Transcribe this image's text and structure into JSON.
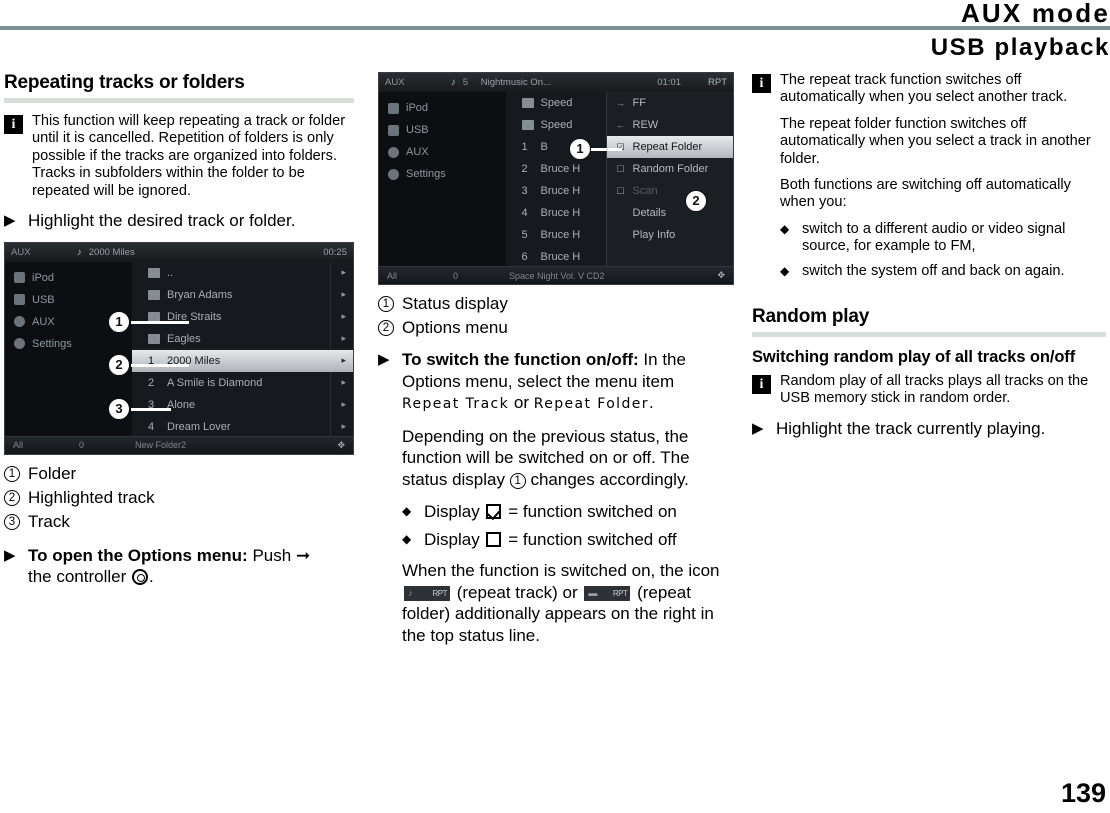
{
  "header": {
    "title": "AUX mode",
    "subtitle": "USB playback",
    "rule_color": "#7e9092"
  },
  "page_number": "139",
  "col1": {
    "section_title": "Repeating tracks or folders",
    "note": [
      "This function will keep repeating a track or folder until it is cancelled. Repetition of folders is only possible if the tracks are organized into folders. Tracks in subfolders within the folder to be repeated will be ignored."
    ],
    "action": "Highlight the desired track or folder.",
    "screenshot": {
      "top": {
        "source": "AUX",
        "icons": "♪",
        "title": "2000 Miles",
        "time": "00:25",
        "rpt": ""
      },
      "nav": [
        "iPod",
        "USB",
        "AUX",
        "Settings"
      ],
      "list": [
        {
          "kind": "folder",
          "label": "..",
          "selected": false
        },
        {
          "kind": "folder",
          "label": "Bryan Adams",
          "selected": false
        },
        {
          "kind": "folder",
          "label": "Dire Straits",
          "selected": false
        },
        {
          "kind": "folder",
          "label": "Eagles",
          "selected": false
        },
        {
          "kind": "track",
          "num": "1",
          "label": "2000 Miles",
          "selected": true
        },
        {
          "kind": "track",
          "num": "2",
          "label": "A Smile is Diamond",
          "selected": false
        },
        {
          "kind": "track",
          "num": "3",
          "label": "Alone",
          "selected": false
        },
        {
          "kind": "track",
          "num": "4",
          "label": "Dream Lover",
          "selected": false
        }
      ],
      "bottom": {
        "b1": "All",
        "b2": "0",
        "b3": "New Folder2",
        "b4": "✥"
      },
      "callouts": [
        "1",
        "2",
        "3"
      ]
    },
    "legend": [
      {
        "num": "1",
        "label": "Folder"
      },
      {
        "num": "2",
        "label": "Highlighted track"
      },
      {
        "num": "3",
        "label": "Track"
      }
    ],
    "action2_bold": "To open the Options menu:",
    "action2_rest": " Push",
    "action2_tail": "the controller"
  },
  "col2": {
    "screenshot": {
      "top": {
        "source": "AUX",
        "icons": "♪",
        "index": "5",
        "title": "Nightmusic On...",
        "time": "01:01",
        "rpt": "RPT"
      },
      "nav": [
        "iPod",
        "USB",
        "AUX",
        "Settings"
      ],
      "list": [
        {
          "kind": "folder",
          "label": "Speed",
          "selected": false
        },
        {
          "kind": "folder",
          "label": "Speed",
          "selected": false
        },
        {
          "kind": "track",
          "num": "1",
          "label": "B",
          "selected": false
        },
        {
          "kind": "track",
          "num": "2",
          "label": "Bruce H",
          "selected": false
        },
        {
          "kind": "track",
          "num": "3",
          "label": "Bruce H",
          "selected": false
        },
        {
          "kind": "track",
          "num": "4",
          "label": "Bruce H",
          "selected": false
        },
        {
          "kind": "track",
          "num": "5",
          "label": "Bruce H",
          "selected": false
        },
        {
          "kind": "track",
          "num": "6",
          "label": "Bruce H",
          "selected": false
        }
      ],
      "options": [
        {
          "label": "FF",
          "glyph": "→",
          "selected": false,
          "dim": false
        },
        {
          "label": "REW",
          "glyph": "←",
          "selected": false,
          "dim": false
        },
        {
          "label": "Repeat Folder",
          "glyph": "☑",
          "selected": true,
          "dim": false
        },
        {
          "label": "Random Folder",
          "glyph": "☐",
          "selected": false,
          "dim": false
        },
        {
          "label": "Scan",
          "glyph": "☐",
          "selected": false,
          "dim": true
        },
        {
          "label": "Details",
          "glyph": "",
          "selected": false,
          "dim": false
        },
        {
          "label": "Play Info",
          "glyph": "",
          "selected": false,
          "dim": false
        }
      ],
      "bottom": {
        "b1": "All",
        "b2": "0",
        "b3": "Space Night Vol. V CD2",
        "b4": "✥"
      },
      "callouts": [
        "1",
        "2"
      ]
    },
    "legend": [
      {
        "num": "1",
        "label": "Status display"
      },
      {
        "num": "2",
        "label": "Options menu"
      }
    ],
    "action_bold": "To switch the function on/off:",
    "action_rest": " In the Options menu, select the menu item ",
    "menu_item_1": "Repeat Track",
    "menu_or": " or ",
    "menu_item_2": "Repeat Folder",
    "menu_period": ".",
    "para1_a": "Depending on the previous status, the function will be switched on or off. The status display ",
    "para1_b": " changes accordingly.",
    "bullets": [
      {
        "pre": "Display ",
        "glyph": "checkbox-checked",
        "post": " = function switched on"
      },
      {
        "pre": "Display ",
        "glyph": "checkbox-empty",
        "post": " = function switched off"
      }
    ],
    "para2_a": "When the function is switched on, the icon ",
    "para2_b": " (repeat track) or ",
    "para2_c": " (repeat folder) additionally appears on the right in the top status line."
  },
  "col3": {
    "note": [
      "The repeat track function switches off automatically when you select another track.",
      "The repeat folder function switches off automatically when you select a track in another folder.",
      "Both functions are switching off automatically when you:"
    ],
    "note_bullets": [
      "switch to a different audio or video signal source, for example to FM,",
      "switch the system off and back on again."
    ],
    "section_title": "Random play",
    "sub_title": "Switching random play of all tracks on/off",
    "note2": "Random play of all tracks plays all tracks on the USB memory stick in random order.",
    "action": "Highlight the track currently playing."
  }
}
